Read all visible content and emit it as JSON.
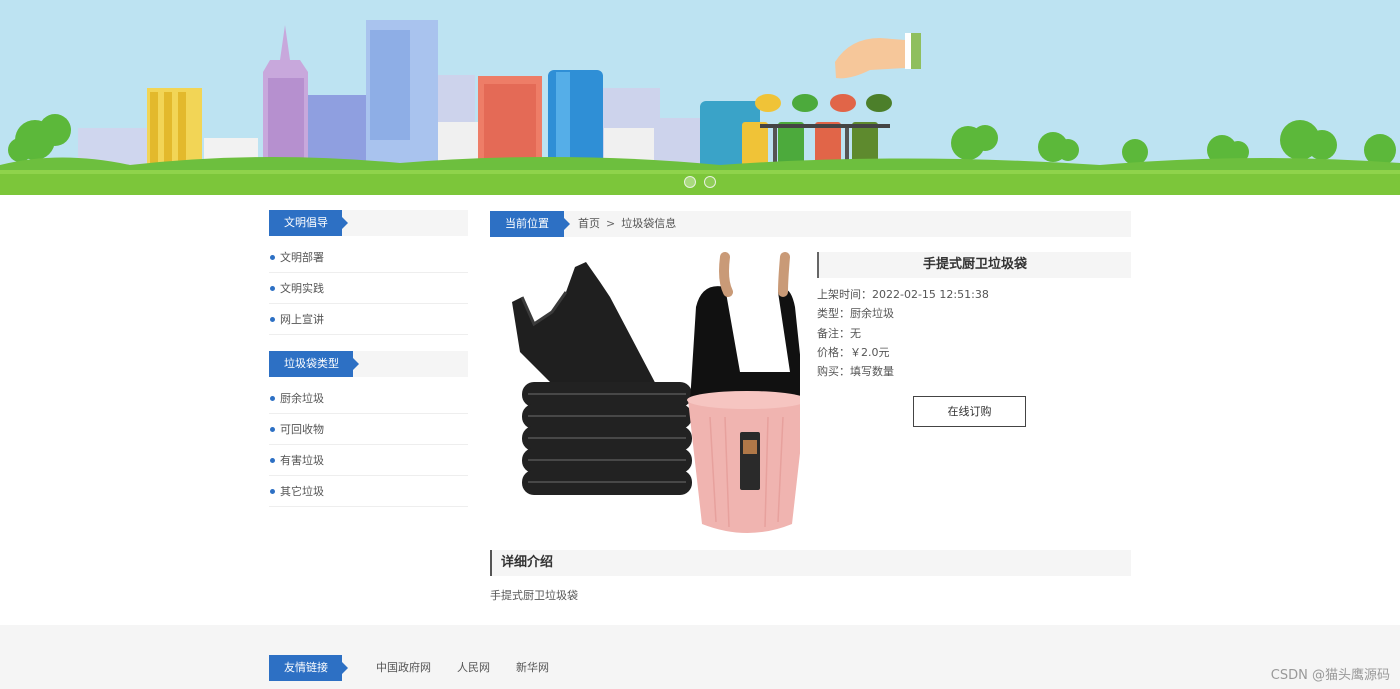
{
  "sidebar": {
    "sections": [
      {
        "title": "文明倡导",
        "items": [
          "文明部署",
          "文明实践",
          "网上宣讲"
        ]
      },
      {
        "title": "垃圾袋类型",
        "items": [
          "厨余垃圾",
          "可回收物",
          "有害垃圾",
          "其它垃圾"
        ]
      }
    ]
  },
  "breadcrumb": {
    "label": "当前位置",
    "home": "首页",
    "separator": ">",
    "current": "垃圾袋信息"
  },
  "product": {
    "title": "手提式厨卫垃圾袋",
    "rows": [
      "上架时间：2022-02-15 12:51:38",
      "类型：厨余垃圾",
      "备注：无",
      "价格：￥2.0元",
      "购买：填写数量"
    ],
    "order_button": "在线订购"
  },
  "detail": {
    "title": "详细介绍",
    "text": "手提式厨卫垃圾袋"
  },
  "footer": {
    "label": "友情链接",
    "links": [
      "中国政府网",
      "人民网",
      "新华网"
    ],
    "watermark": "CSDN @猫头鹰源码"
  },
  "colors": {
    "accent": "#2d70c4",
    "sky": "#bde3f2",
    "grass": "#7cc63a"
  },
  "icons": [
    "recycle-icon",
    "hand-icon",
    "trash-bin-icon"
  ]
}
